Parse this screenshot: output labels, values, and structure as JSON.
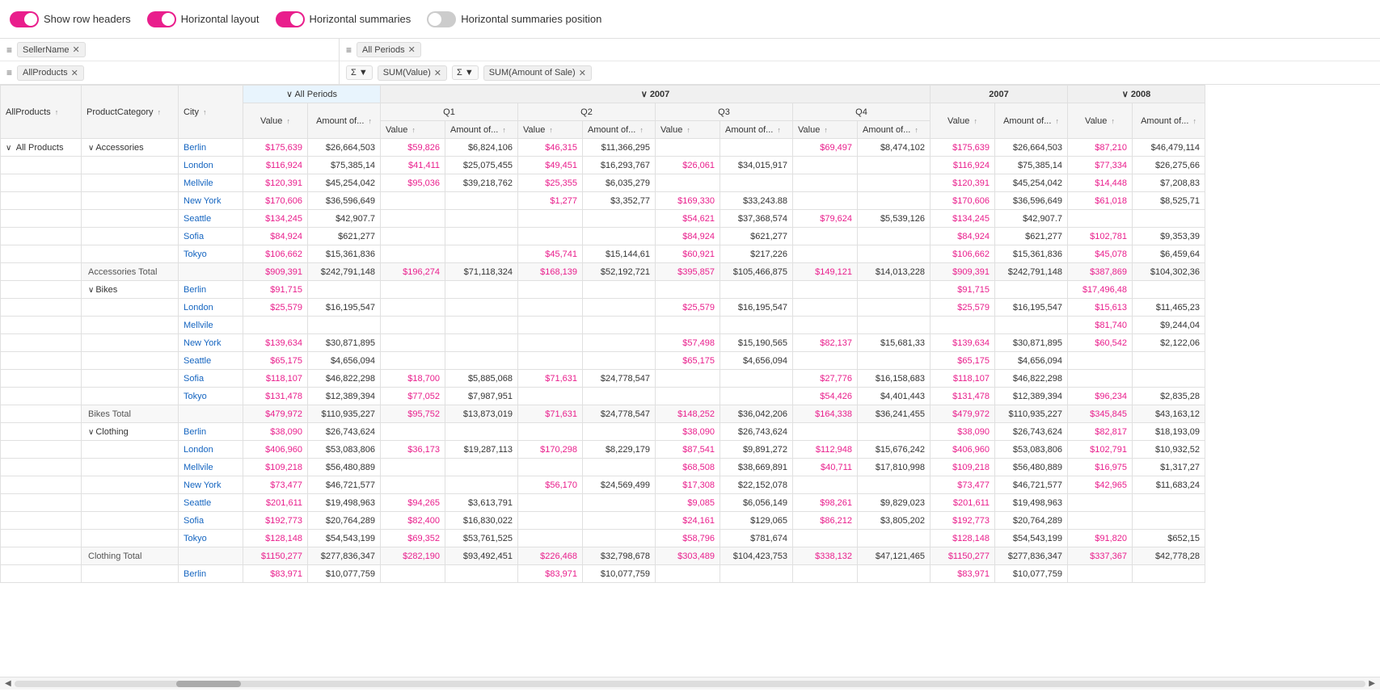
{
  "toolbar": {
    "show_row_headers": {
      "label": "Show row headers",
      "state": "on"
    },
    "horizontal_layout": {
      "label": "Horizontal layout",
      "state": "on"
    },
    "horizontal_summaries": {
      "label": "Horizontal summaries",
      "state": "on"
    },
    "horizontal_summaries_position": {
      "label": "Horizontal summaries position",
      "state": "off"
    }
  },
  "filters": {
    "left_row1": {
      "icon": "≡",
      "tag": "SellerName",
      "close": "✕"
    },
    "left_row2": {
      "icon": "≡",
      "tag": "AllProducts",
      "close": "✕"
    },
    "right_row1": {
      "icon": "≡",
      "tag": "All Periods",
      "close": "✕"
    },
    "right_row2a": {
      "sigma": "Σ",
      "arrow": "▼",
      "tag": "SUM(Value)",
      "close": "✕"
    },
    "right_row2b": {
      "sigma": "Σ",
      "arrow": "▼",
      "tag": "SUM(Amount of Sale)",
      "close": "✕"
    }
  },
  "col_headers": {
    "all_products": "AllProducts",
    "product_category": "ProductCategory",
    "city": "City",
    "all_periods": "All Periods",
    "year2007": "2007",
    "year2008": "2008",
    "q1": "Q1",
    "q2": "Q2",
    "q3": "Q3",
    "q4": "Q4",
    "value": "Value",
    "amount": "Amount of..."
  },
  "rows": [
    {
      "category": "",
      "subcategory": "Accessories",
      "city": "Berlin",
      "q1v": "$59,826",
      "q1a": "$6,824,106",
      "q2v": "$46,315",
      "q2a": "$11,366,295",
      "q3v": "",
      "q3a": "",
      "q4v": "$69,497",
      "q4a": "$8,474,102",
      "yv": "$175,639",
      "ya": "$26,664,503",
      "y8q1v": "$87,210",
      "y8q1a": "$46,479,114",
      "pink1": true,
      "pink2": true,
      "pink4": true,
      "pinky": true,
      "pinky8": true
    },
    {
      "category": "",
      "subcategory": "Accessories",
      "city": "London",
      "q1v": "$41,411",
      "q1a": "$25,075,455",
      "q2v": "$49,451",
      "q2a": "$16,293,767",
      "q3v": "$26,061",
      "q3a": "$34,015,917",
      "q4v": "",
      "q4a": "",
      "yv": "$116,924",
      "ya": "$75,385,14",
      "y8q1v": "$77,334",
      "y8q1a": "$26,275,66",
      "pink1": true,
      "pink2": true,
      "pink3": true,
      "pinky": true,
      "pinky8": true
    },
    {
      "category": "",
      "subcategory": "Accessories",
      "city": "Mellvile",
      "q1v": "$95,036",
      "q1a": "$39,218,762",
      "q2v": "$25,355",
      "q2a": "$6,035,279",
      "q3v": "",
      "q3a": "",
      "q4v": "",
      "q4a": "",
      "yv": "$120,391",
      "ya": "$45,254,042",
      "y8q1v": "$14,448",
      "y8q1a": "$7,208,83",
      "pink1": true,
      "pink2": true,
      "pinky": true,
      "pinky8": true
    },
    {
      "category": "",
      "subcategory": "Accessories",
      "city": "New York",
      "q1v": "",
      "q1a": "",
      "q2v": "$1,277",
      "q2a": "$3,352,77",
      "q3v": "$169,330",
      "q3a": "$33,243.88",
      "q4v": "",
      "q4a": "",
      "yv": "$170,606",
      "ya": "$36,596,649",
      "y8q1v": "$61,018",
      "y8q1a": "$8,525,71",
      "pink2": true,
      "pink3": true,
      "pinky": true,
      "pinky8": true
    },
    {
      "category": "",
      "subcategory": "Accessories",
      "city": "Seattle",
      "q1v": "",
      "q1a": "",
      "q2v": "",
      "q2a": "",
      "q3v": "$54,621",
      "q3a": "$37,368,574",
      "q4v": "$79,624",
      "q4a": "$5,539,126",
      "yv": "$134,245",
      "ya": "$42,907.7",
      "y8q1v": "",
      "y8q1a": "",
      "pink3": true,
      "pink4": true,
      "pinky": true
    },
    {
      "category": "",
      "subcategory": "Accessories",
      "city": "Sofia",
      "q1v": "",
      "q1a": "",
      "q2v": "",
      "q2a": "",
      "q3v": "$84,924",
      "q3a": "$621,277",
      "q4v": "",
      "q4a": "",
      "yv": "$84,924",
      "ya": "$621,277",
      "y8q1v": "$102,781",
      "y8q1a": "$9,353,39",
      "pink3": true,
      "pinky": true,
      "pinky8": true
    },
    {
      "category": "",
      "subcategory": "Accessories",
      "city": "Tokyo",
      "q1v": "",
      "q1a": "",
      "q2v": "$45,741",
      "q2a": "$15,144,61",
      "q3v": "$60,921",
      "q3a": "$217,226",
      "q4v": "",
      "q4a": "",
      "yv": "$106,662",
      "ya": "$15,361,836",
      "y8q1v": "$45,078",
      "y8q1a": "$6,459,64",
      "pink2": true,
      "pink3": true,
      "pinky": true,
      "pinky8": true
    },
    {
      "isTotal": true,
      "label": "Accessories Total",
      "q1v": "$196,274",
      "q1a": "$71,118,324",
      "q2v": "$168,139",
      "q2a": "$52,192,721",
      "q3v": "$395,857",
      "q3a": "$105,466,875",
      "q4v": "$149,121",
      "q4a": "$14,013,228",
      "yv": "$909,391",
      "ya": "$242,791,148",
      "y8q1v": "$387,869",
      "y8q1a": "$104,302,36",
      "pink1": true,
      "pink2": true,
      "pink3": true,
      "pink4": true,
      "pinky": true,
      "pinky8": true
    },
    {
      "category": "",
      "subcategory": "Bikes",
      "city": "Berlin",
      "q1v": "",
      "q1a": "",
      "q2v": "",
      "q2a": "",
      "q3v": "",
      "q3a": "",
      "q4v": "",
      "q4a": "",
      "yv": "$91,715",
      "ya": "",
      "y8q1v": "$17,496,48",
      "y8q1a": "",
      "pinky": true,
      "pinky8": true
    },
    {
      "category": "",
      "subcategory": "Bikes",
      "city": "London",
      "q1v": "",
      "q1a": "",
      "q2v": "",
      "q2a": "",
      "q3v": "$25,579",
      "q3a": "$16,195,547",
      "q4v": "",
      "q4a": "",
      "yv": "$25,579",
      "ya": "$16,195,547",
      "y8q1v": "$15,613",
      "y8q1a": "$11,465,23",
      "pink3": true,
      "pinky": true,
      "pinky8": true
    },
    {
      "category": "",
      "subcategory": "Bikes",
      "city": "Mellvile",
      "q1v": "",
      "q1a": "",
      "q2v": "",
      "q2a": "",
      "q3v": "",
      "q3a": "",
      "q4v": "",
      "q4a": "",
      "yv": "",
      "ya": "",
      "y8q1v": "$81,740",
      "y8q1a": "$9,244,04",
      "pinky8": true
    },
    {
      "category": "",
      "subcategory": "Bikes",
      "city": "New York",
      "q1v": "",
      "q1a": "",
      "q2v": "",
      "q2a": "",
      "q3v": "$57,498",
      "q3a": "$15,190,565",
      "q4v": "$82,137",
      "q4a": "$15,681,33",
      "yv": "$139,634",
      "ya": "$30,871,895",
      "y8q1v": "$60,542",
      "y8q1a": "$2,122,06",
      "pink3": true,
      "pink4": true,
      "pinky": true,
      "pinky8": true
    },
    {
      "category": "",
      "subcategory": "Bikes",
      "city": "Seattle",
      "q1v": "",
      "q1a": "",
      "q2v": "",
      "q2a": "",
      "q3v": "$65,175",
      "q3a": "$4,656,094",
      "q4v": "",
      "q4a": "",
      "yv": "$65,175",
      "ya": "$4,656,094",
      "y8q1v": "",
      "y8q1a": "",
      "pink3": true,
      "pinky": true
    },
    {
      "category": "",
      "subcategory": "Bikes",
      "city": "Sofia",
      "q1v": "$18,700",
      "q1a": "$5,885,068",
      "q2v": "$71,631",
      "q2a": "$24,778,547",
      "q3v": "",
      "q3a": "",
      "q4v": "$27,776",
      "q4a": "$16,158,683",
      "yv": "$118,107",
      "ya": "$46,822,298",
      "y8q1v": "",
      "y8q1a": "",
      "pink1": true,
      "pink2": true,
      "pink4": true,
      "pinky": true
    },
    {
      "category": "",
      "subcategory": "Bikes",
      "city": "Tokyo",
      "q1v": "$77,052",
      "q1a": "$7,987,951",
      "q2v": "",
      "q2a": "",
      "q3v": "",
      "q3a": "",
      "q4v": "$54,426",
      "q4a": "$4,401,443",
      "yv": "$131,478",
      "ya": "$12,389,394",
      "y8q1v": "$96,234",
      "y8q1a": "$2,835,28",
      "pink1": true,
      "pink4": true,
      "pinky": true,
      "pinky8": true
    },
    {
      "isTotal": true,
      "label": "Bikes Total",
      "q1v": "$95,752",
      "q1a": "$13,873,019",
      "q2v": "$71,631",
      "q2a": "$24,778,547",
      "q3v": "$148,252",
      "q3a": "$36,042,206",
      "q4v": "$164,338",
      "q4a": "$36,241,455",
      "yv": "$479,972",
      "ya": "$110,935,227",
      "y8q1v": "$345,845",
      "y8q1a": "$43,163,12",
      "pink1": true,
      "pink2": true,
      "pink3": true,
      "pink4": true,
      "pinky": true,
      "pinky8": true
    },
    {
      "category": "",
      "subcategory": "Clothing",
      "city": "Berlin",
      "q1v": "",
      "q1a": "",
      "q2v": "",
      "q2a": "",
      "q3v": "$38,090",
      "q3a": "$26,743,624",
      "q4v": "",
      "q4a": "",
      "yv": "$38,090",
      "ya": "$26,743,624",
      "y8q1v": "$82,817",
      "y8q1a": "$18,193,09",
      "pink3": true,
      "pinky": true,
      "pinky8": true
    },
    {
      "category": "",
      "subcategory": "Clothing",
      "city": "London",
      "q1v": "$36,173",
      "q1a": "$19,287,113",
      "q2v": "$170,298",
      "q2a": "$8,229,179",
      "q3v": "$87,541",
      "q3a": "$9,891,272",
      "q4v": "$112,948",
      "q4a": "$15,676,242",
      "yv": "$406,960",
      "ya": "$53,083,806",
      "y8q1v": "$102,791",
      "y8q1a": "$10,932,52",
      "pink1": true,
      "pink2": true,
      "pink3": true,
      "pink4": true,
      "pinky": true,
      "pinky8": true
    },
    {
      "category": "",
      "subcategory": "Clothing",
      "city": "Mellvile",
      "q1v": "",
      "q1a": "",
      "q2v": "",
      "q2a": "",
      "q3v": "$68,508",
      "q3a": "$38,669,891",
      "q4v": "$40,711",
      "q4a": "$17,810,998",
      "yv": "$109,218",
      "ya": "$56,480,889",
      "y8q1v": "$16,975",
      "y8q1a": "$1,317,27",
      "pink3": true,
      "pink4": true,
      "pinky": true,
      "pinky8": true
    },
    {
      "category": "",
      "subcategory": "Clothing",
      "city": "New York",
      "q1v": "",
      "q1a": "",
      "q2v": "$56,170",
      "q2a": "$24,569,499",
      "q3v": "$17,308",
      "q3a": "$22,152,078",
      "q4v": "",
      "q4a": "",
      "yv": "$73,477",
      "ya": "$46,721,577",
      "y8q1v": "$42,965",
      "y8q1a": "$11,683,24",
      "pink2": true,
      "pink3": true,
      "pinky": true,
      "pinky8": true
    },
    {
      "category": "",
      "subcategory": "Clothing",
      "city": "Seattle",
      "q1v": "$94,265",
      "q1a": "$3,613,791",
      "q2v": "",
      "q2a": "",
      "q3v": "$9,085",
      "q3a": "$6,056,149",
      "q4v": "$98,261",
      "q4a": "$9,829,023",
      "yv": "$201,611",
      "ya": "$19,498,963",
      "y8q1v": "",
      "y8q1a": "",
      "pink1": true,
      "pink3": true,
      "pink4": true,
      "pinky": true
    },
    {
      "category": "",
      "subcategory": "Clothing",
      "city": "Sofia",
      "q1v": "$82,400",
      "q1a": "$16,830,022",
      "q2v": "",
      "q2a": "",
      "q3v": "$24,161",
      "q3a": "$129,065",
      "q4v": "$86,212",
      "q4a": "$3,805,202",
      "yv": "$192,773",
      "ya": "$20,764,289",
      "y8q1v": "",
      "y8q1a": "",
      "pink1": true,
      "pink3": true,
      "pink4": true,
      "pinky": true
    },
    {
      "category": "",
      "subcategory": "Clothing",
      "city": "Tokyo",
      "q1v": "$69,352",
      "q1a": "$53,761,525",
      "q2v": "",
      "q2a": "",
      "q3v": "$58,796",
      "q3a": "$781,674",
      "q4v": "",
      "q4a": "",
      "yv": "$128,148",
      "ya": "$54,543,199",
      "y8q1v": "$91,820",
      "y8q1a": "$652,15",
      "pink1": true,
      "pink3": true,
      "pinky": true,
      "pinky8": true
    },
    {
      "isTotal": true,
      "label": "Clothing Total",
      "q1v": "$282,190",
      "q1a": "$93,492,451",
      "q2v": "$226,468",
      "q2a": "$32,798,678",
      "q3v": "$303,489",
      "q3a": "$104,423,753",
      "q4v": "$338,132",
      "q4a": "$47,121,465",
      "yv": "$1150,277",
      "ya": "$277,836,347",
      "y8q1v": "$337,367",
      "y8q1a": "$42,778,28",
      "pink1": true,
      "pink2": true,
      "pink3": true,
      "pink4": true,
      "pinky": true,
      "pinky8": true
    },
    {
      "category": "",
      "subcategory": "",
      "city": "Berlin",
      "q1v": "",
      "q1a": "",
      "q2v": "$83,971",
      "q2a": "$10,077,759",
      "q3v": "",
      "q3a": "",
      "q4v": "",
      "q4a": "",
      "yv": "$83,971",
      "ya": "$10,077,759",
      "y8q1v": "",
      "y8q1a": "",
      "pink2": true,
      "pinky": true
    }
  ]
}
